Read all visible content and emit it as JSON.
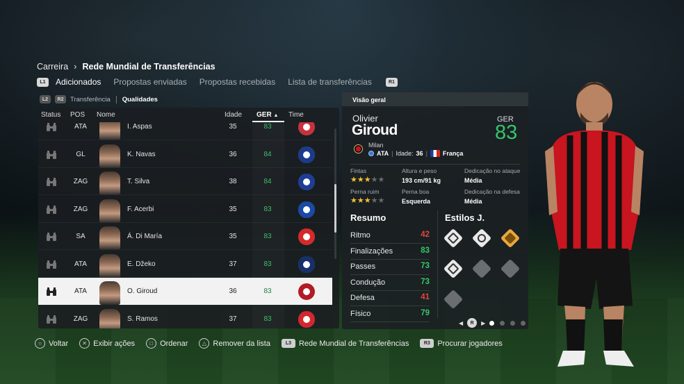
{
  "breadcrumb": {
    "parent": "Carreira",
    "current": "Rede Mundial de Transferências"
  },
  "tabs": {
    "left_button": "L1",
    "right_button": "R1",
    "items": [
      "Adicionados",
      "Propostas enviadas",
      "Propostas recebidas",
      "Lista de transferências"
    ],
    "active": "Adicionados"
  },
  "subtabs": {
    "left_buttons": [
      "L2",
      "R2"
    ],
    "items": [
      "Transferência",
      "Qualidades"
    ],
    "active": "Qualidades"
  },
  "columns": {
    "status": "Status",
    "pos": "POS",
    "name": "Nome",
    "age": "Idade",
    "ger": "GER",
    "team": "Time"
  },
  "players": [
    {
      "pos": "ATA",
      "name": "I. Aspas",
      "age": "35",
      "ger": "83",
      "club_icon": "celta-crest",
      "club_color": "#c8323c"
    },
    {
      "pos": "GL",
      "name": "K. Navas",
      "age": "36",
      "ger": "84",
      "club_icon": "psg-crest",
      "club_color": "#1b3c8c"
    },
    {
      "pos": "ZAG",
      "name": "T. Silva",
      "age": "38",
      "ger": "84",
      "club_icon": "chelsea-crest",
      "club_color": "#1d3d96"
    },
    {
      "pos": "ZAG",
      "name": "F. Acerbi",
      "age": "35",
      "ger": "83",
      "club_icon": "inter-crest",
      "club_color": "#1a49a6"
    },
    {
      "pos": "SA",
      "name": "Á. Di María",
      "age": "35",
      "ger": "83",
      "club_icon": "benfica-crest",
      "club_color": "#d42a2a"
    },
    {
      "pos": "ATA",
      "name": "E. Džeko",
      "age": "37",
      "ger": "83",
      "club_icon": "fenerbahce-crest",
      "club_color": "#16306b"
    },
    {
      "pos": "ATA",
      "name": "O. Giroud",
      "age": "36",
      "ger": "83",
      "club_icon": "milan-crest",
      "club_color": "#b31b25",
      "selected": true
    },
    {
      "pos": "ZAG",
      "name": "S. Ramos",
      "age": "37",
      "ger": "83",
      "club_icon": "sevilla-crest",
      "club_color": "#d4272e"
    }
  ],
  "detail": {
    "header": "Visão geral",
    "first_name": "Olivier",
    "last_name": "Giroud",
    "ger_label": "GER",
    "ger_value": "83",
    "club": "Milan",
    "position": "ATA",
    "age_label": "Idade:",
    "age": "36",
    "nationality": "França",
    "attributes": {
      "fintas_label": "Fintas",
      "fintas_stars": 3,
      "height_label": "Altura e peso",
      "height_value": "193 cm/91 kg",
      "attack_label": "Dedicação no ataque",
      "attack_value": "Média",
      "weak_foot_label": "Perna ruim",
      "weak_foot_stars": 3,
      "good_foot_label": "Perna boa",
      "good_foot_value": "Esquerda",
      "defense_label": "Dedicação na defesa",
      "defense_value": "Média"
    },
    "summary_title": "Resumo",
    "styles_title": "Estilos J.",
    "stats": [
      {
        "label": "Ritmo",
        "value": "42",
        "color": "#e0453e"
      },
      {
        "label": "Finalizações",
        "value": "83",
        "color": "#35c66a"
      },
      {
        "label": "Passes",
        "value": "73",
        "color": "#35c66a"
      },
      {
        "label": "Condução",
        "value": "73",
        "color": "#35c66a"
      },
      {
        "label": "Defesa",
        "value": "41",
        "color": "#e0453e"
      },
      {
        "label": "Físico",
        "value": "79",
        "color": "#35c66a"
      }
    ],
    "pager_button": "R",
    "pager_pages": 4,
    "pager_active": 0
  },
  "footer": [
    {
      "icon": "circle-button-icon",
      "glyph": "○",
      "label": "Voltar"
    },
    {
      "icon": "cross-button-icon",
      "glyph": "✕",
      "label": "Exibir ações"
    },
    {
      "icon": "square-button-icon",
      "glyph": "□",
      "label": "Ordenar"
    },
    {
      "icon": "triangle-button-icon",
      "glyph": "△",
      "label": "Remover da lista"
    },
    {
      "icon": "l3-button-icon",
      "glyph": "L3",
      "label": "Rede Mundial de Transferências"
    },
    {
      "icon": "r3-button-icon",
      "glyph": "R3",
      "label": "Procurar jogadores"
    }
  ]
}
